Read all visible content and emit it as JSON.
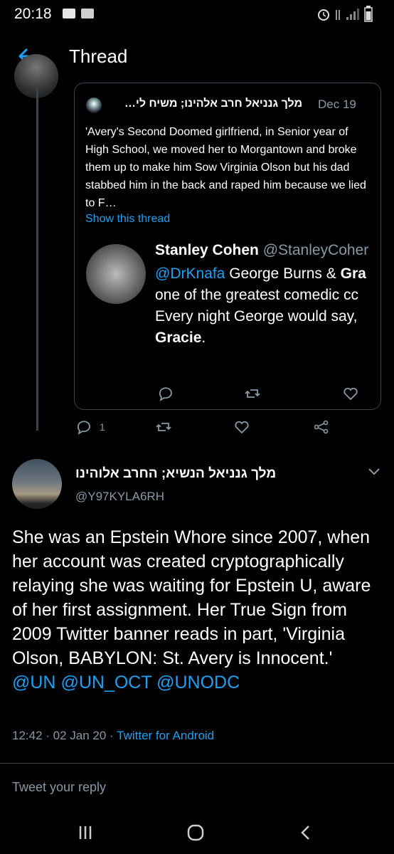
{
  "status_bar": {
    "time": "20:18"
  },
  "header": {
    "title": "Thread"
  },
  "quote": {
    "author_name": "מלך גנניאל חרב אלהינו; משיח לי…",
    "date": "Dec 19",
    "text": "'Avery's Second Doomed girlfriend, in Senior year of High School, we moved her to Morgantown and broke them up to make him Sow Virginia Olson but his dad stabbed him in the back and raped him because we lied to F…",
    "show_thread": "Show this thread",
    "inner": {
      "author_name": "Stanley Cohen",
      "author_handle": "@StanleyCoher",
      "line1_mention": "@DrKnafa",
      "line1_text": " George Burns & ",
      "line1_bold": "Gra",
      "line2": "one of the greatest comedic cc",
      "line3": "Every night George would say,",
      "line4_bold": "Gracie",
      "line4_end": "."
    }
  },
  "main_tweet": {
    "reply_count": "1",
    "author_name": "מלך גנניאל הנשיא; החרב אלוהינו",
    "author_handle": "@Y97KYLA6RH",
    "text": "She was an Epstein Whore since 2007, when her account was created cryptographically relaying she was waiting for Epstein U, aware of her first assignment. Her True Sign from 2009 Twitter banner reads in part, 'Virginia Olson, BABYLON: St. Avery is Innocent.'",
    "mentions": [
      "@UN",
      "@UN_OCT",
      "@UNODC"
    ],
    "time": "12:42 · 02 Jan 20 · ",
    "client": "Twitter for Android"
  },
  "reply_bar": {
    "placeholder": "Tweet your reply"
  },
  "colors": {
    "accent": "#1da1f2",
    "muted": "#8899a6",
    "border": "#38444d",
    "background": "#000000"
  }
}
